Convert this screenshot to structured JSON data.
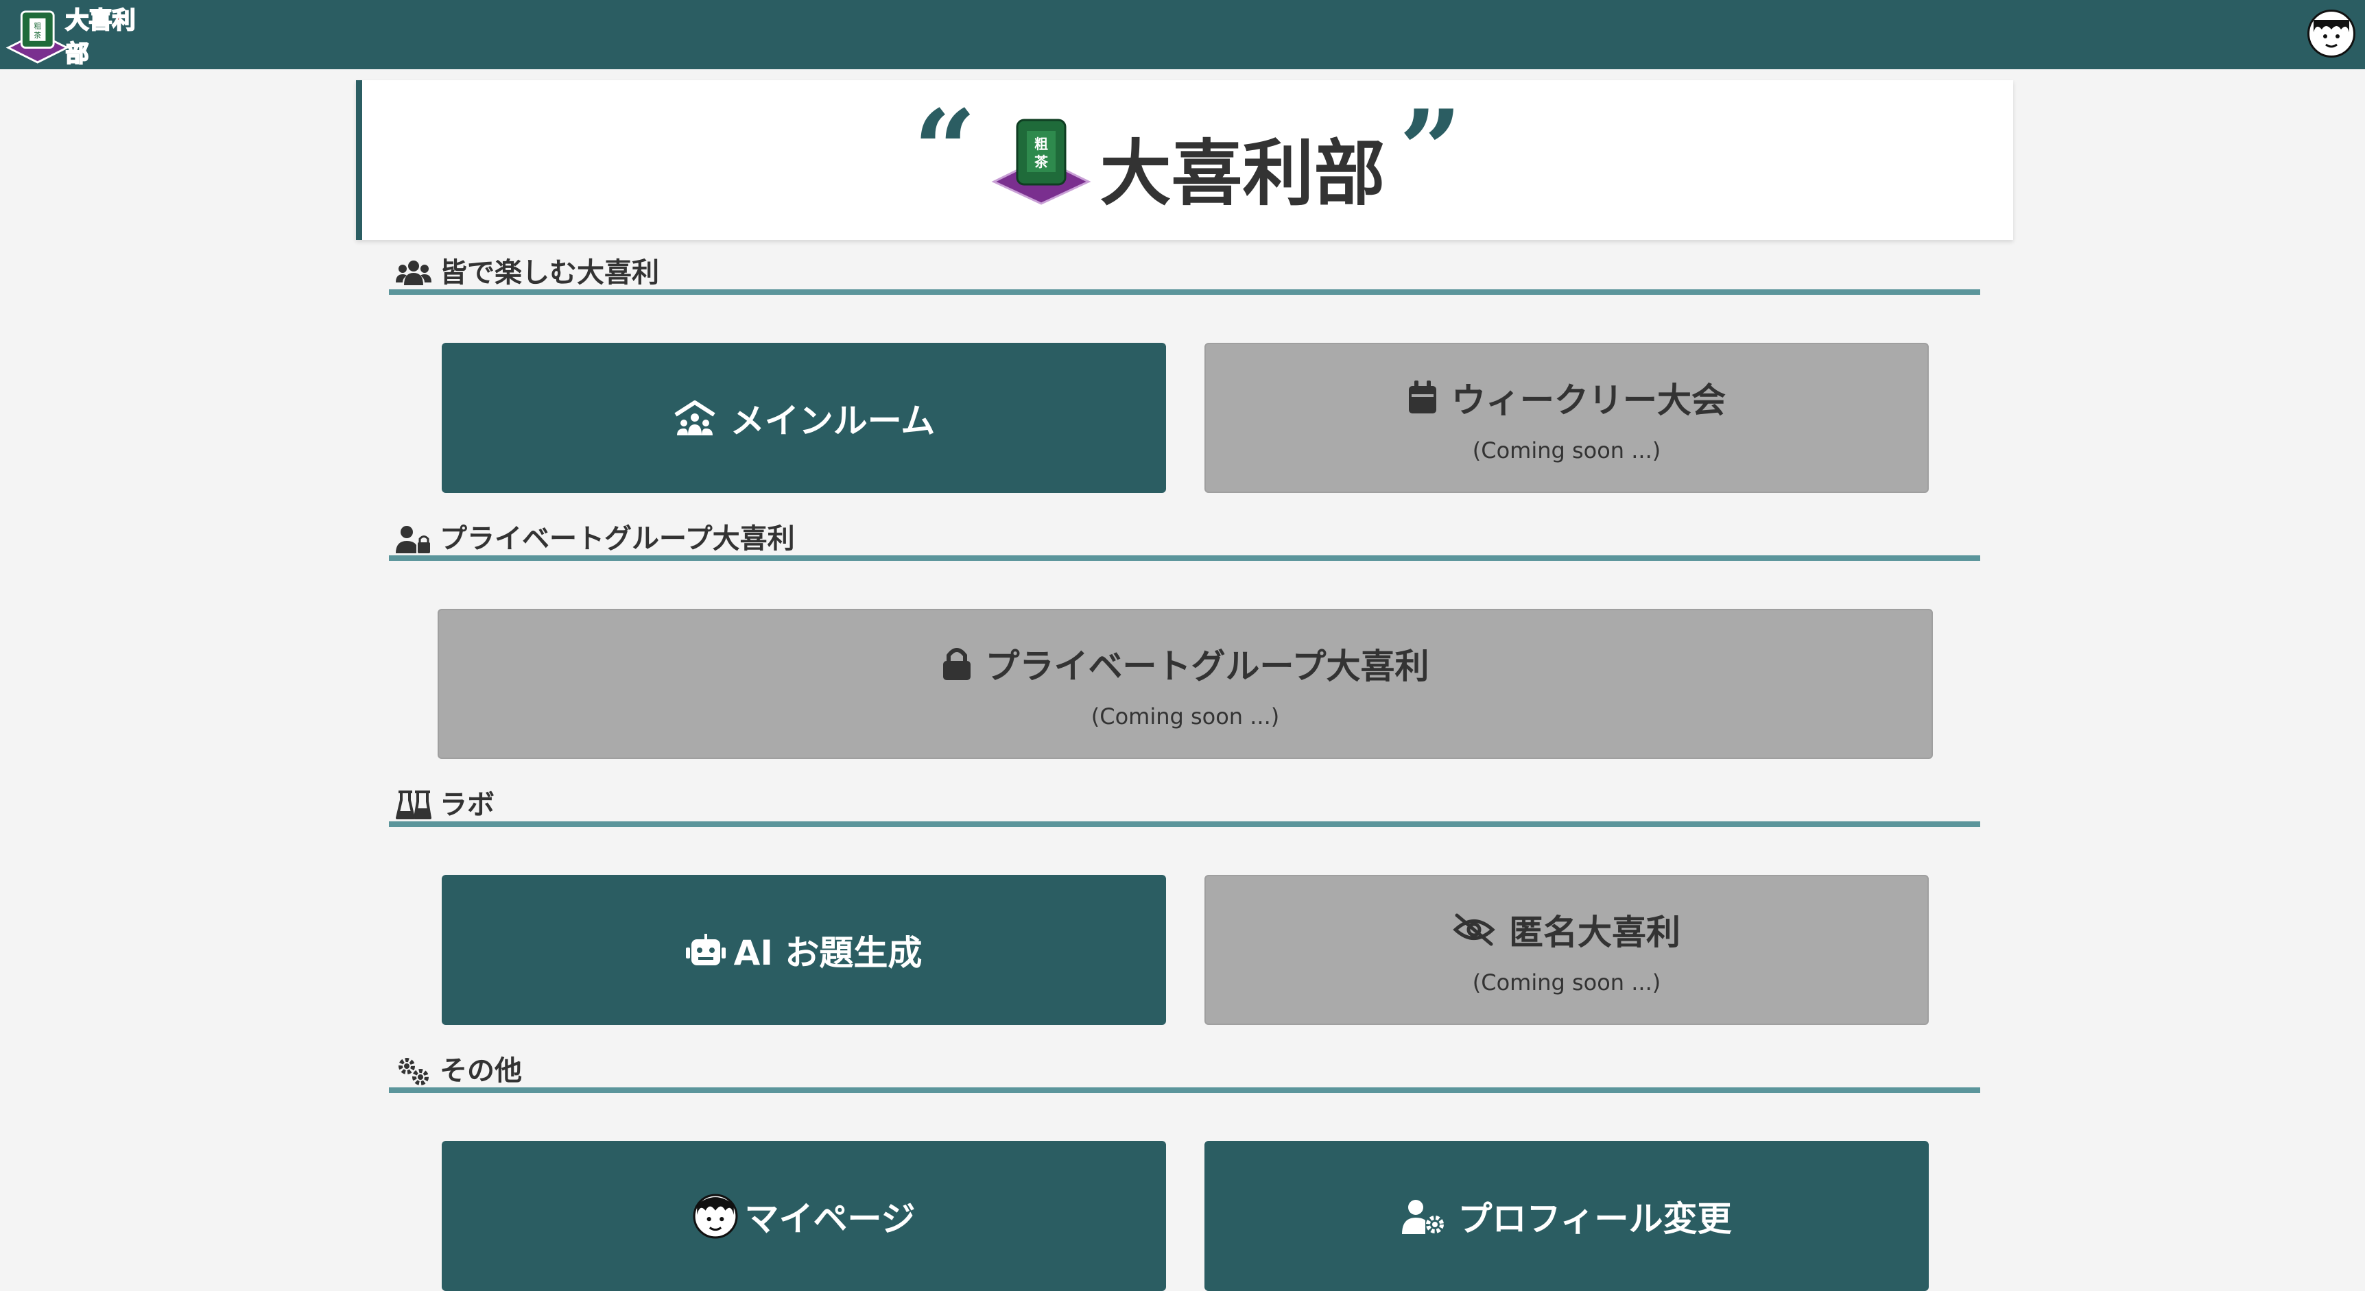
{
  "app": {
    "logo_text": "大喜利部",
    "logo_badge": "粗茶"
  },
  "banner": {
    "title": "大喜利部",
    "open_quote": "“",
    "close_quote": "”",
    "badge_text": "粗茶"
  },
  "sections": {
    "everyone": {
      "label": "皆で楽しむ大喜利",
      "icon": "users-icon"
    },
    "private": {
      "label": "プライベートグループ大喜利",
      "icon": "user-lock-icon"
    },
    "lab": {
      "label": "ラボ",
      "icon": "flask-icon"
    },
    "other": {
      "label": "その他",
      "icon": "gears-icon"
    }
  },
  "cards": {
    "main_room": {
      "label": "メインルーム",
      "icon": "people-roof-icon"
    },
    "weekly": {
      "label": "ウィークリー大会",
      "sub": "(Coming soon ...)",
      "icon": "calendar-icon"
    },
    "private_group": {
      "label": "プライベートグループ大喜利",
      "sub": "(Coming soon ...)",
      "icon": "lock-icon"
    },
    "ai_topic": {
      "label": "AI お題生成",
      "icon": "robot-icon"
    },
    "anonymous": {
      "label": "匿名大喜利",
      "sub": "(Coming soon ...)",
      "icon": "eye-slash-icon"
    },
    "my_page": {
      "label": "マイページ",
      "icon": "avatar-icon"
    },
    "profile": {
      "label": "プロフィール変更",
      "icon": "user-gear-icon"
    }
  },
  "colors": {
    "primary": "#2b5d62",
    "accent_line": "#5b959b",
    "disabled": "#aaaaaa",
    "background": "#f4f4f4",
    "logo_red": "#d22a2a",
    "cushion_purple": "#7a2f8f"
  }
}
